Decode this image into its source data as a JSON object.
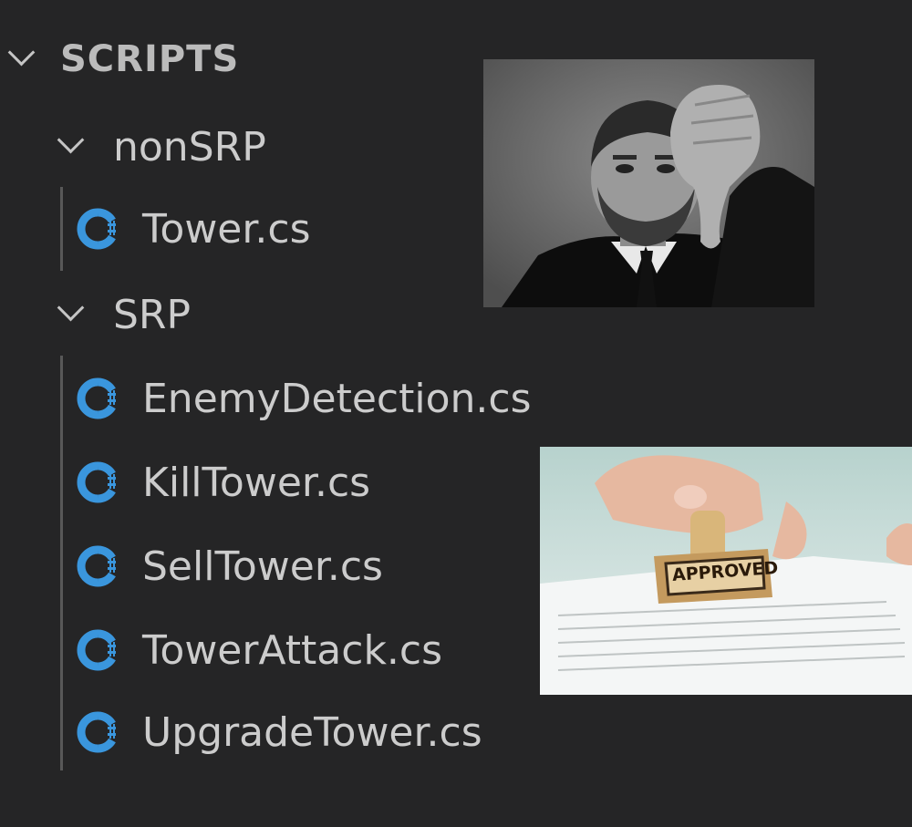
{
  "explorer": {
    "section_title": "SCRIPTS",
    "folders": [
      {
        "label": "nonSRP",
        "files": [
          "Tower.cs"
        ]
      },
      {
        "label": "SRP",
        "files": [
          "EnemyDetection.cs",
          "KillTower.cs",
          "SellTower.cs",
          "TowerAttack.cs",
          "UpgradeTower.cs"
        ]
      }
    ]
  },
  "overlays": {
    "disapproval_photo": {
      "subject": "man giving thumbs down",
      "tone": "grayscale"
    },
    "approval_photo": {
      "subject": "hand stamping document",
      "stamp_text": "APPROVED"
    }
  },
  "colors": {
    "background": "#252526",
    "text": "#cccccc",
    "csharp_icon": "#3a96dd",
    "indent_guide": "#585858"
  }
}
